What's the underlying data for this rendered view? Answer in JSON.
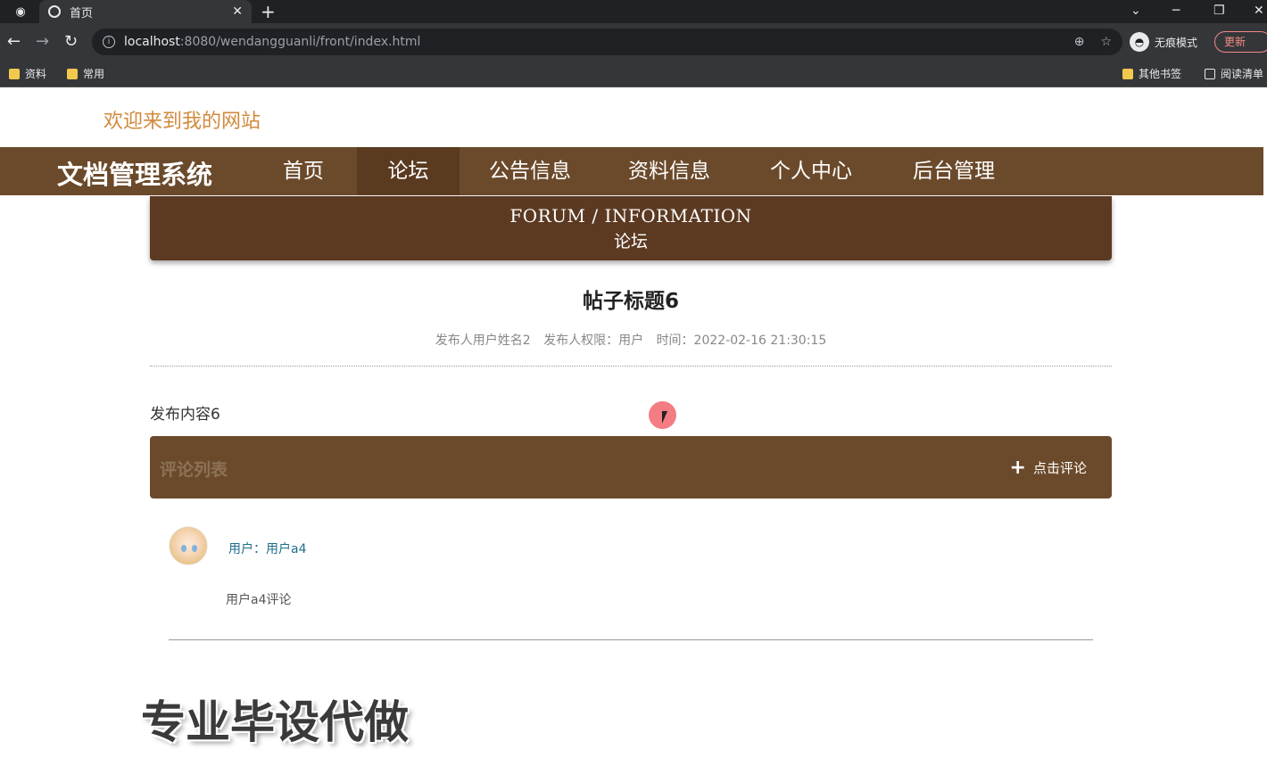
{
  "browser": {
    "tab_title": "首页",
    "tab_close": "✕",
    "new_tab": "+",
    "url_host": "localhost",
    "url_rest": ":8080/wendangguanli/front/index.html",
    "incognito_label": "无痕模式",
    "update_label": "更新",
    "bookmarks": [
      "资料",
      "常用"
    ],
    "bookmarks_right": [
      "其他书签",
      "阅读清单"
    ]
  },
  "header": {
    "welcome": "欢迎来到我的网站",
    "brand": "文档管理系统",
    "nav": [
      {
        "label": "首页",
        "active": false
      },
      {
        "label": "论坛",
        "active": true
      },
      {
        "label": "公告信息",
        "active": false
      },
      {
        "label": "资料信息",
        "active": false
      },
      {
        "label": "个人中心",
        "active": false
      },
      {
        "label": "后台管理",
        "active": false
      }
    ]
  },
  "banner": {
    "english": "FORUM / INFORMATION",
    "chinese": "论坛"
  },
  "post": {
    "title": "帖子标题6",
    "author": "发布人用户姓名2",
    "role": "发布人权限：用户",
    "time": "时间：2022-02-16 21:30:15",
    "content": "发布内容6"
  },
  "comments": {
    "list_title": "评论列表",
    "add_label": "点击评论",
    "items": [
      {
        "user": "用户：用户a4",
        "text": "用户a4评论"
      }
    ]
  },
  "overlay": {
    "watermark": "专业毕设代做"
  },
  "colors": {
    "nav_bg": "#6b4a2b",
    "nav_active": "#5a3b20",
    "banner_bg": "#5c3a22",
    "welcome": "#d08a3c"
  }
}
